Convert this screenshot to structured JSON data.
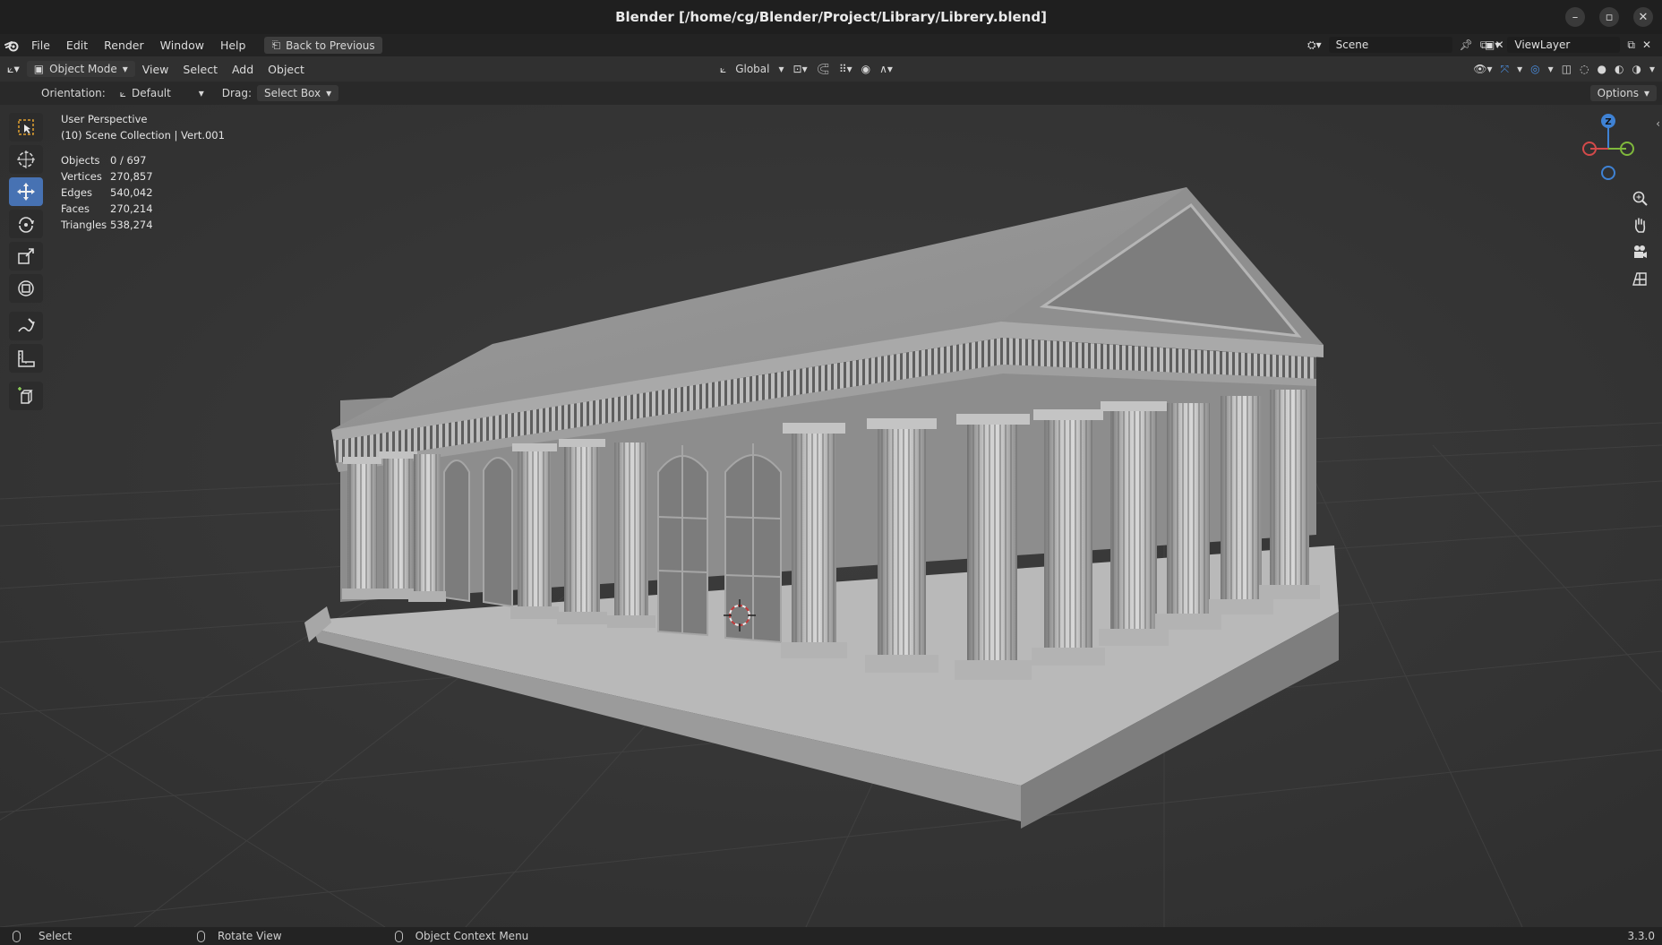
{
  "window": {
    "title": "Blender [/home/cg/Blender/Project/Library/Librery.blend]",
    "controls": [
      "minimize-icon",
      "maximize-icon",
      "close-icon"
    ]
  },
  "menubar": {
    "items": [
      "File",
      "Edit",
      "Render",
      "Window",
      "Help"
    ],
    "back_label": "Back to Previous"
  },
  "scene": {
    "label": "Scene"
  },
  "view_layer": {
    "label": "ViewLayer"
  },
  "viewport_header": {
    "mode": "Object Mode",
    "menus": [
      "View",
      "Select",
      "Add",
      "Object"
    ],
    "transform_orientation": "Global"
  },
  "tool_settings": {
    "orientation_label": "Orientation:",
    "orientation_value": "Default",
    "drag_label": "Drag:",
    "drag_value": "Select Box",
    "options_label": "Options"
  },
  "overlay": {
    "perspective": "User Perspective",
    "collection": "(10) Scene Collection | Vert.001",
    "stats": [
      {
        "label": "Objects",
        "value": "0 / 697"
      },
      {
        "label": "Vertices",
        "value": "270,857"
      },
      {
        "label": "Edges",
        "value": "540,042"
      },
      {
        "label": "Faces",
        "value": "270,214"
      },
      {
        "label": "Triangles",
        "value": "538,274"
      }
    ]
  },
  "toolbar": {
    "tools": [
      "select-box-icon",
      "cursor-icon",
      "move-icon",
      "rotate-icon",
      "scale-icon",
      "transform-icon",
      "annotate-icon",
      "measure-icon",
      "add-cube-icon"
    ],
    "active": "move-icon"
  },
  "gizmo": {
    "z_label": "Z",
    "axes_colors": {
      "x": "#d34a4a",
      "y": "#7fb83c",
      "z": "#3f82d4"
    }
  },
  "statusbar": {
    "items": [
      "Select",
      "Rotate View",
      "Object Context Menu"
    ],
    "version": "3.3.0"
  },
  "colors": {
    "accent": "#4772b3",
    "background": "#393939",
    "header": "#303030"
  }
}
